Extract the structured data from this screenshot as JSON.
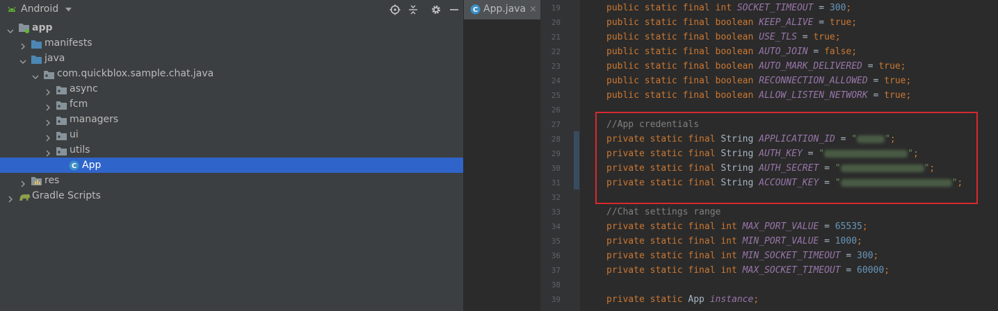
{
  "project_panel": {
    "view_title": "Android",
    "tree": [
      {
        "label": "app",
        "bold": true,
        "indent": 0,
        "expanded": true,
        "icon": "module-folder-icon"
      },
      {
        "label": "manifests",
        "indent": 1,
        "expanded": false,
        "icon": "folder-icon"
      },
      {
        "label": "java",
        "indent": 1,
        "expanded": true,
        "icon": "folder-icon"
      },
      {
        "label": "com.quickblox.sample.chat.java",
        "indent": 2,
        "expanded": true,
        "icon": "package-icon"
      },
      {
        "label": "async",
        "indent": 3,
        "expanded": false,
        "icon": "package-icon"
      },
      {
        "label": "fcm",
        "indent": 3,
        "expanded": false,
        "icon": "package-icon"
      },
      {
        "label": "managers",
        "indent": 3,
        "expanded": false,
        "icon": "package-icon"
      },
      {
        "label": "ui",
        "indent": 3,
        "expanded": false,
        "icon": "package-icon"
      },
      {
        "label": "utils",
        "indent": 3,
        "expanded": false,
        "icon": "package-icon"
      },
      {
        "label": "App",
        "indent": 4,
        "expanded": null,
        "icon": "java-class-icon",
        "selected": true
      },
      {
        "label": "res",
        "indent": 1,
        "expanded": false,
        "icon": "resources-folder-icon"
      },
      {
        "label": "Gradle Scripts",
        "indent": 0,
        "expanded": false,
        "icon": "gradle-icon"
      }
    ]
  },
  "editor": {
    "tab": {
      "label": "App.java",
      "close": "×"
    },
    "lines": [
      {
        "n": "19",
        "tokens": [
          [
            "kw",
            "public static final "
          ],
          [
            "kw",
            "int "
          ],
          [
            "const",
            "SOCKET_TIMEOUT"
          ],
          [
            "pl",
            " = "
          ],
          [
            "num",
            "300"
          ],
          [
            "kw",
            ";"
          ]
        ]
      },
      {
        "n": "20",
        "tokens": [
          [
            "kw",
            "public static final boolean "
          ],
          [
            "const",
            "KEEP_ALIVE"
          ],
          [
            "pl",
            " = "
          ],
          [
            "kw",
            "true;"
          ]
        ]
      },
      {
        "n": "21",
        "tokens": [
          [
            "kw",
            "public static final boolean "
          ],
          [
            "const",
            "USE_TLS"
          ],
          [
            "pl",
            " = "
          ],
          [
            "kw",
            "true;"
          ]
        ]
      },
      {
        "n": "22",
        "tokens": [
          [
            "kw",
            "public static final boolean "
          ],
          [
            "const",
            "AUTO_JOIN"
          ],
          [
            "pl",
            " = "
          ],
          [
            "kw",
            "false;"
          ]
        ]
      },
      {
        "n": "23",
        "tokens": [
          [
            "kw",
            "public static final boolean "
          ],
          [
            "const",
            "AUTO_MARK_DELIVERED"
          ],
          [
            "pl",
            " = "
          ],
          [
            "kw",
            "true;"
          ]
        ]
      },
      {
        "n": "24",
        "tokens": [
          [
            "kw",
            "public static final boolean "
          ],
          [
            "const",
            "RECONNECTION_ALLOWED"
          ],
          [
            "pl",
            " = "
          ],
          [
            "kw",
            "true;"
          ]
        ]
      },
      {
        "n": "25",
        "tokens": [
          [
            "kw",
            "public static final boolean "
          ],
          [
            "const",
            "ALLOW_LISTEN_NETWORK"
          ],
          [
            "pl",
            " = "
          ],
          [
            "kw",
            "true;"
          ]
        ]
      },
      {
        "n": "26",
        "tokens": []
      },
      {
        "n": "27",
        "tokens": [
          [
            "cmt",
            "//App credentials"
          ]
        ]
      },
      {
        "n": "28",
        "tokens": [
          [
            "kw",
            "private static final "
          ],
          [
            "pl",
            "String "
          ],
          [
            "const",
            "APPLICATION_ID"
          ],
          [
            "pl",
            " = "
          ],
          [
            "str",
            "\""
          ],
          [
            "blur",
            "40"
          ],
          [
            "str",
            "\""
          ],
          [
            "kw",
            ";"
          ]
        ]
      },
      {
        "n": "29",
        "tokens": [
          [
            "kw",
            "private static final "
          ],
          [
            "pl",
            "String "
          ],
          [
            "const",
            "AUTH_KEY"
          ],
          [
            "pl",
            " = "
          ],
          [
            "str",
            "\""
          ],
          [
            "blur",
            "120"
          ],
          [
            "str",
            "\""
          ],
          [
            "kw",
            ";"
          ]
        ]
      },
      {
        "n": "30",
        "tokens": [
          [
            "kw",
            "private static final "
          ],
          [
            "pl",
            "String "
          ],
          [
            "const",
            "AUTH_SECRET"
          ],
          [
            "pl",
            " = "
          ],
          [
            "str",
            "\""
          ],
          [
            "blur",
            "120"
          ],
          [
            "str",
            "\""
          ],
          [
            "kw",
            ";"
          ]
        ]
      },
      {
        "n": "31",
        "tokens": [
          [
            "kw",
            "private static final "
          ],
          [
            "pl",
            "String "
          ],
          [
            "const",
            "ACCOUNT_KEY"
          ],
          [
            "pl",
            " = "
          ],
          [
            "str",
            "\""
          ],
          [
            "blur",
            "160"
          ],
          [
            "str",
            "\""
          ],
          [
            "kw",
            ";"
          ]
        ]
      },
      {
        "n": "32",
        "tokens": []
      },
      {
        "n": "33",
        "tokens": [
          [
            "cmt",
            "//Chat settings range"
          ]
        ]
      },
      {
        "n": "34",
        "tokens": [
          [
            "kw",
            "private static final int "
          ],
          [
            "const",
            "MAX_PORT_VALUE"
          ],
          [
            "pl",
            " = "
          ],
          [
            "num",
            "65535"
          ],
          [
            "kw",
            ";"
          ]
        ]
      },
      {
        "n": "35",
        "tokens": [
          [
            "kw",
            "private static final int "
          ],
          [
            "const",
            "MIN_PORT_VALUE"
          ],
          [
            "pl",
            " = "
          ],
          [
            "num",
            "1000"
          ],
          [
            "kw",
            ";"
          ]
        ]
      },
      {
        "n": "36",
        "tokens": [
          [
            "kw",
            "private static final int "
          ],
          [
            "const",
            "MIN_SOCKET_TIMEOUT"
          ],
          [
            "pl",
            " = "
          ],
          [
            "num",
            "300"
          ],
          [
            "kw",
            ";"
          ]
        ]
      },
      {
        "n": "37",
        "tokens": [
          [
            "kw",
            "private static final int "
          ],
          [
            "const",
            "MAX_SOCKET_TIMEOUT"
          ],
          [
            "pl",
            " = "
          ],
          [
            "num",
            "60000"
          ],
          [
            "kw",
            ";"
          ]
        ]
      },
      {
        "n": "38",
        "tokens": []
      },
      {
        "n": "39",
        "tokens": [
          [
            "kw",
            "private static "
          ],
          [
            "pl",
            "App "
          ],
          [
            "const",
            "instance"
          ],
          [
            "kw",
            ";"
          ]
        ]
      }
    ]
  },
  "colors": {
    "selection": "#2f65ca",
    "highlight_box": "#d9282f",
    "keyword": "#cc7832",
    "constant": "#9876aa",
    "number": "#6897bb",
    "string": "#6a8759",
    "comment": "#808080"
  }
}
